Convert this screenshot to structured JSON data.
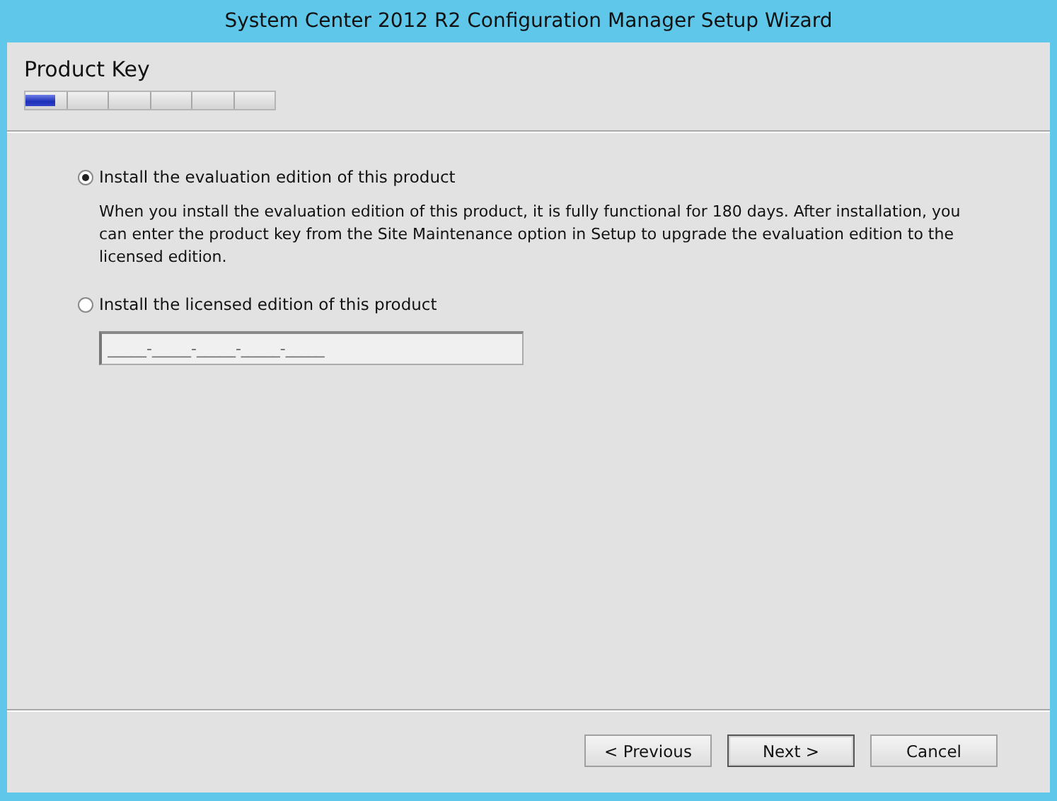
{
  "window": {
    "title": "System Center 2012 R2 Configuration Manager Setup Wizard"
  },
  "page": {
    "title": "Product Key",
    "progress": {
      "level": 0.12
    }
  },
  "options": [
    {
      "label": "Install the evaluation edition of this product",
      "selected": true,
      "description": "When you install the evaluation edition of this product, it is fully functional for 180 days. After installation, you can enter the product key from the Site Maintenance option in Setup to upgrade the evaluation edition to the licensed edition."
    },
    {
      "label": "Install the licensed edition of this product",
      "selected": false,
      "key_field": {
        "value": "_____-_____-_____-_____-_____",
        "disabled": true
      }
    }
  ],
  "buttons": [
    {
      "label": "< Previous",
      "default": false
    },
    {
      "label": "Next >",
      "default": true
    },
    {
      "label": "Cancel",
      "default": false
    }
  ]
}
